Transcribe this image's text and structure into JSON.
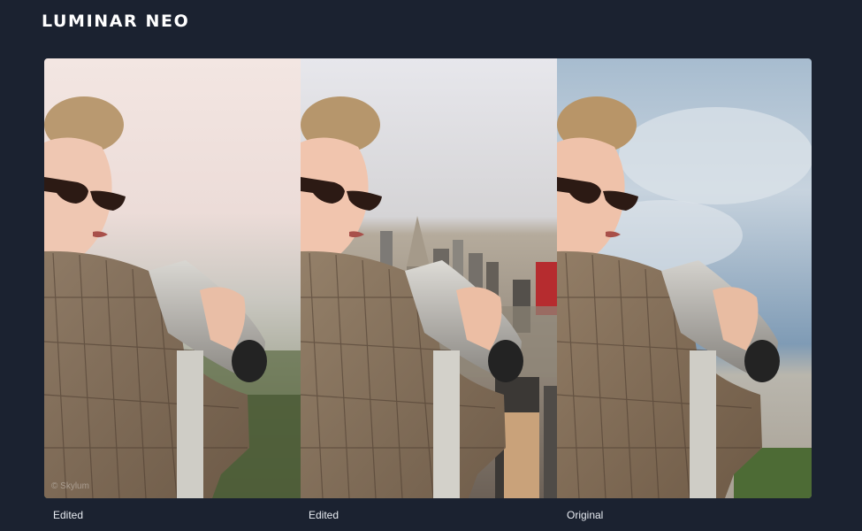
{
  "header": {
    "logo_text": "LUMINAR NEO"
  },
  "panels": [
    {
      "caption": "Edited",
      "watermark": "© Skylum"
    },
    {
      "caption": "Edited"
    },
    {
      "caption": "Original"
    }
  ],
  "colors": {
    "background": "#1b2230",
    "caption_text": "#e8ecf2",
    "logo_text": "#ffffff"
  }
}
